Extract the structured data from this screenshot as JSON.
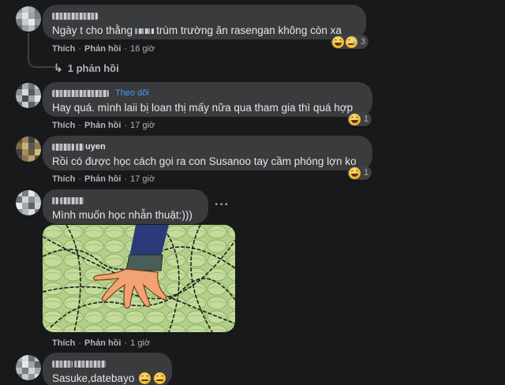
{
  "comments": [
    {
      "name": "",
      "text_before": "Ngày t cho thằng",
      "text_after": "trùm trường ăn rasengan không còn xa",
      "like_label": "Thích",
      "reply_label": "Phản hồi",
      "time": "16 giờ",
      "reaction_count": "3",
      "reactions": [
        "haha-icon",
        "sad-icon"
      ],
      "replies_link": "1 phản hồi"
    },
    {
      "name": "",
      "badge": "Theo dõi",
      "text": "Hay quá. mình laii bị loan thị mấy nữa qua tham gia thì quá hợp",
      "like_label": "Thích",
      "reply_label": "Phản hồi",
      "time": "17 giờ",
      "reaction_count": "1",
      "reactions": [
        "haha-icon"
      ]
    },
    {
      "name": "uyen",
      "text": "Rồi có được học cách gọi ra con Susanoo tay cầm phóng lợn ko",
      "like_label": "Thích",
      "reply_label": "Phản hồi",
      "time": "17 giờ",
      "reaction_count": "1",
      "reactions": [
        "haha-icon"
      ]
    },
    {
      "name": "",
      "text": "Mình muốn học nhẫn thuật:)))",
      "like_label": "Thích",
      "reply_label": "Phản hồi",
      "time": "1 giờ",
      "more_label": "···",
      "image_alt": "anime-hand-jutsu-image"
    },
    {
      "name": "",
      "text": "Sasuke,datebayo",
      "trailing_emojis": [
        "sad-face-icon",
        "sad-face-icon"
      ]
    }
  ],
  "colors": {
    "background": "#18191a",
    "bubble": "#3a3b3c",
    "text": "#e4e6eb",
    "secondary": "#b0b3b8",
    "link_blue": "#4599ff"
  }
}
